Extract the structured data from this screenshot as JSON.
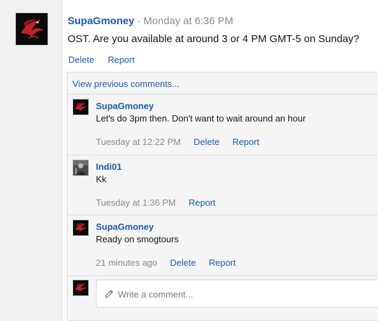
{
  "post": {
    "username": "SupaGmoney",
    "separator": "·",
    "time": "Monday at 6:36 PM",
    "text": "OST. Are you available at around 3 or 4 PM GMT-5 on Sunday?",
    "delete_label": "Delete",
    "report_label": "Report",
    "avatar_icon": "dragon-avatar-icon"
  },
  "comments": {
    "view_previous": "View previous comments...",
    "items": [
      {
        "username": "SupaGmoney",
        "text": "Let's do 3pm then. Don't want to wait around an hour",
        "time": "Tuesday at 12:22 PM",
        "delete_label": "Delete",
        "report_label": "Report",
        "avatar_icon": "dragon-avatar-icon"
      },
      {
        "username": "Indi01",
        "text": "Kk",
        "time": "Tuesday at 1:36 PM",
        "report_label": "Report",
        "avatar_icon": "person-avatar-icon"
      },
      {
        "username": "SupaGmoney",
        "text": "Ready on smogtours",
        "time": "21 minutes ago",
        "delete_label": "Delete",
        "report_label": "Report",
        "avatar_icon": "dragon-avatar-icon"
      }
    ],
    "write_placeholder": "Write a comment..."
  },
  "colors": {
    "link": "#1f5aa7",
    "muted": "#8a8a8a",
    "avatar_red": "#c0202a"
  }
}
